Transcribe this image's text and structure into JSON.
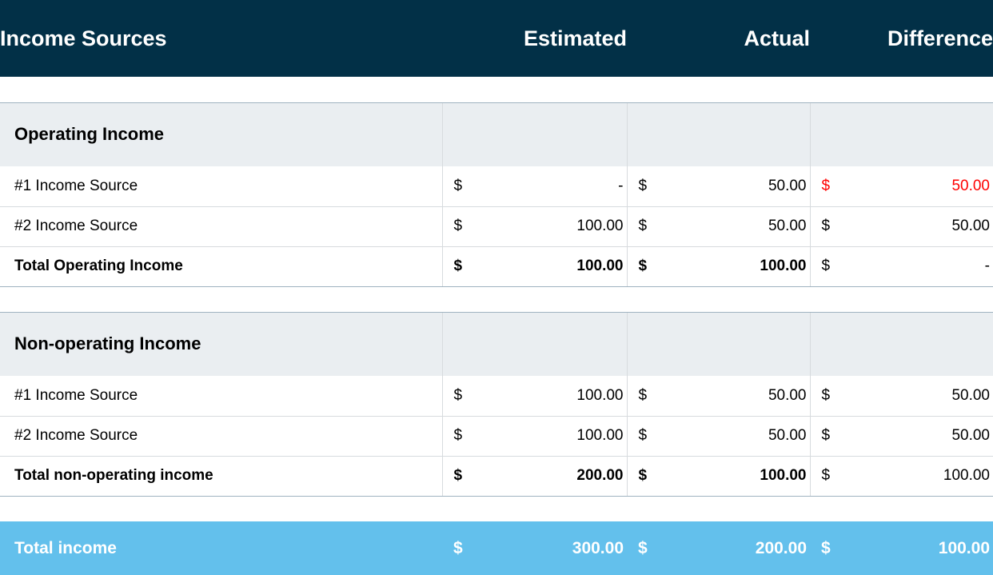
{
  "table": {
    "header": {
      "label": "Income Sources",
      "estimated": "Estimated",
      "actual": "Actual",
      "difference": "Difference"
    },
    "currency_symbol": "$",
    "colors": {
      "header_bg": "#023047",
      "section_bg": "#eaeef1",
      "grand_total_bg": "#63c0ec",
      "negative_text": "#ff0000",
      "grid_line": "#d7dbde",
      "section_rule": "#9fb3c0"
    },
    "sections": [
      {
        "title": "Operating Income",
        "rows": [
          {
            "label": "#1 Income Source",
            "bold": false,
            "estimated": {
              "symbol": "$",
              "value": "-",
              "bold": false,
              "negative": false
            },
            "actual": {
              "symbol": "$",
              "value": "50.00",
              "bold": false,
              "negative": false
            },
            "difference": {
              "symbol": "$",
              "value": "50.00",
              "bold": false,
              "negative": true
            }
          },
          {
            "label": "#2 Income Source",
            "bold": false,
            "estimated": {
              "symbol": "$",
              "value": "100.00",
              "bold": false,
              "negative": false
            },
            "actual": {
              "symbol": "$",
              "value": "50.00",
              "bold": false,
              "negative": false
            },
            "difference": {
              "symbol": "$",
              "value": "50.00",
              "bold": false,
              "negative": false
            }
          },
          {
            "label": "Total Operating Income",
            "bold": true,
            "estimated": {
              "symbol": "$",
              "value": "100.00",
              "bold": true,
              "negative": false
            },
            "actual": {
              "symbol": "$",
              "value": "100.00",
              "bold": true,
              "negative": false
            },
            "difference": {
              "symbol": "$",
              "value": "-",
              "bold": false,
              "negative": false
            }
          }
        ]
      },
      {
        "title": "Non-operating Income",
        "rows": [
          {
            "label": "#1 Income Source",
            "bold": false,
            "estimated": {
              "symbol": "$",
              "value": "100.00",
              "bold": false,
              "negative": false
            },
            "actual": {
              "symbol": "$",
              "value": "50.00",
              "bold": false,
              "negative": false
            },
            "difference": {
              "symbol": "$",
              "value": "50.00",
              "bold": false,
              "negative": false
            }
          },
          {
            "label": "#2 Income Source",
            "bold": false,
            "estimated": {
              "symbol": "$",
              "value": "100.00",
              "bold": false,
              "negative": false
            },
            "actual": {
              "symbol": "$",
              "value": "50.00",
              "bold": false,
              "negative": false
            },
            "difference": {
              "symbol": "$",
              "value": "50.00",
              "bold": false,
              "negative": false
            }
          },
          {
            "label": "Total non-operating income",
            "bold": true,
            "estimated": {
              "symbol": "$",
              "value": "200.00",
              "bold": true,
              "negative": false
            },
            "actual": {
              "symbol": "$",
              "value": "100.00",
              "bold": true,
              "negative": false
            },
            "difference": {
              "symbol": "$",
              "value": "100.00",
              "bold": false,
              "negative": false
            }
          }
        ]
      }
    ],
    "grand_total": {
      "label": "Total income",
      "estimated": {
        "symbol": "$",
        "value": "300.00"
      },
      "actual": {
        "symbol": "$",
        "value": "200.00"
      },
      "difference": {
        "symbol": "$",
        "value": "100.00"
      }
    }
  }
}
